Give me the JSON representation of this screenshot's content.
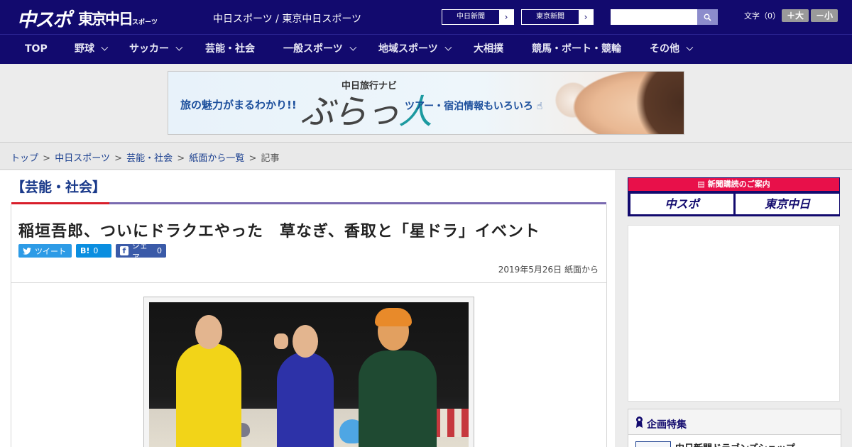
{
  "header": {
    "logo_main": "中スポ",
    "logo_tokyo": "東京中日",
    "logo_tokyo_sub": "スポーツ",
    "site_title": "中日スポーツ / 東京中日スポーツ",
    "btn_chunichi": "中日新聞",
    "btn_tokyo": "東京新聞",
    "search_placeholder": "",
    "fontsize_label": "文字（0）",
    "fs_bigger": "＋大",
    "fs_smaller": "－小"
  },
  "nav": {
    "items": [
      {
        "label": "TOP",
        "dropdown": false
      },
      {
        "label": "野球",
        "dropdown": true
      },
      {
        "label": "サッカー",
        "dropdown": true
      },
      {
        "label": "芸能・社会",
        "dropdown": false
      },
      {
        "label": "一般スポーツ",
        "dropdown": true
      },
      {
        "label": "地域スポーツ",
        "dropdown": true
      },
      {
        "label": "大相撲",
        "dropdown": false
      },
      {
        "label": "競馬・ボート・競輪",
        "dropdown": false
      },
      {
        "label": "その他",
        "dropdown": true
      }
    ]
  },
  "banner": {
    "left_text": "旅の魅力がまるわかり!!",
    "top_text": "中日旅行ナビ",
    "brand": "ぶらっ",
    "brand_accent": "人",
    "right_text": "ツアー・宿泊情報もいろいろ"
  },
  "breadcrumb": {
    "items": [
      "トップ",
      "中日スポーツ",
      "芸能・社会",
      "紙面から一覧"
    ],
    "current": "記事",
    "separator": ">"
  },
  "article": {
    "category": "【芸能・社会】",
    "title": "稲垣吾郎、ついにドラクエやった　草なぎ、香取と「星ドラ」イベント",
    "share_tweet": "ツイート",
    "share_hatena_label": "B!",
    "share_hatena_count": "0",
    "share_fb_label": "シェア",
    "share_fb_count": "0",
    "date": "2019年5月26日 紙面から"
  },
  "sidebar": {
    "subscribe_title": "新聞購読のご案内",
    "subscribe_chuspo": "中スポ",
    "subscribe_tokyo": "東京中日",
    "feature_title": "企画特集",
    "feature_item": "中日新聞ドラゴンズショップ"
  },
  "colors": {
    "header_bg": "#120a6e",
    "category_red": "#d81e2a",
    "category_purple": "#7a6ab0",
    "subscribe_red": "#e8104a",
    "twitter": "#2d9be6",
    "hatena": "#0a8ee0",
    "facebook": "#3a5aa8"
  }
}
